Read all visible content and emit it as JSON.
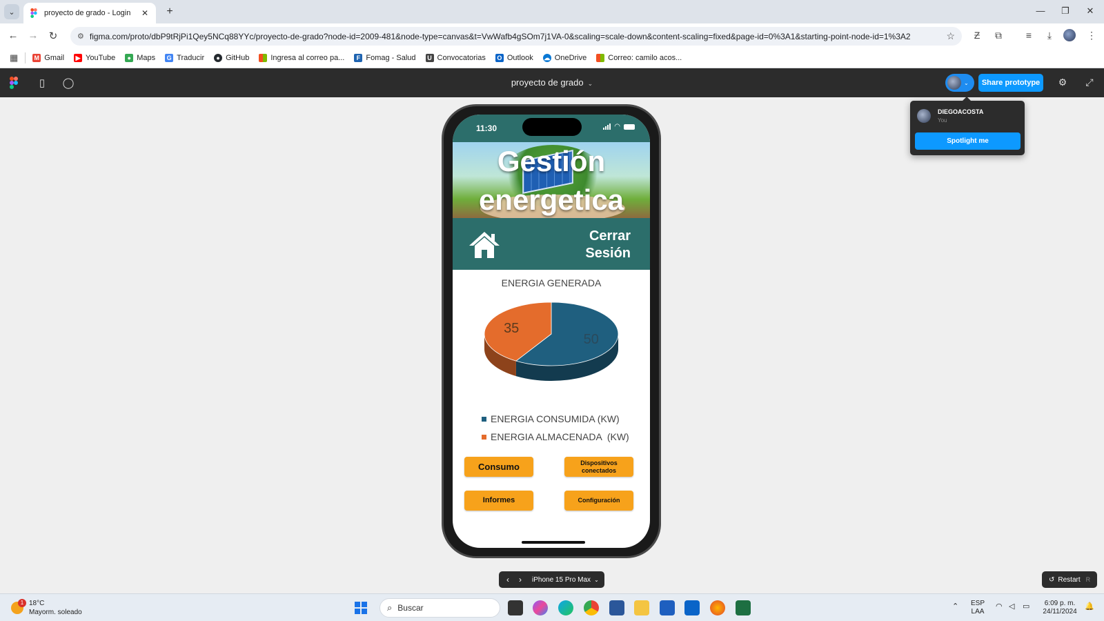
{
  "browser": {
    "tab_title": "proyecto de grado - Login",
    "url": "figma.com/proto/dbP9tRjPi1Qey5NCq88YYc/proyecto-de-grado?node-id=2009-481&node-type=canvas&t=VwWafb4gSOm7j1VA-0&scaling=scale-down&content-scaling=fixed&page-id=0%3A1&starting-point-node-id=1%3A2",
    "bookmarks": [
      {
        "label": "Gmail",
        "icon": "gmail-icon",
        "color": "#ea4335"
      },
      {
        "label": "YouTube",
        "icon": "youtube-icon",
        "color": "#ff0000"
      },
      {
        "label": "Maps",
        "icon": "maps-icon",
        "color": "#34a853"
      },
      {
        "label": "Traducir",
        "icon": "translate-icon",
        "color": "#4285f4"
      },
      {
        "label": "GitHub",
        "icon": "github-icon",
        "color": "#24292e"
      },
      {
        "label": "Ingresa al correo pa...",
        "icon": "microsoft-icon",
        "color": "#f25022"
      },
      {
        "label": "Fomag - Salud",
        "icon": "fomag-icon",
        "color": "#1e63b0"
      },
      {
        "label": "Convocatorias",
        "icon": "convocatorias-icon",
        "color": "#444444"
      },
      {
        "label": "Outlook",
        "icon": "outlook-icon",
        "color": "#0a64c8"
      },
      {
        "label": "OneDrive",
        "icon": "onedrive-icon",
        "color": "#0a78d4"
      },
      {
        "label": "Correo: camilo acos...",
        "icon": "microsoft-icon",
        "color": "#f25022"
      }
    ]
  },
  "figma": {
    "file_title": "proyecto de grado",
    "share_label": "Share prototype",
    "popover": {
      "name": "DIEGOACOSTA",
      "sub": "You",
      "spotlight_label": "Spotlight me"
    },
    "device_name": "iPhone 15 Pro Max",
    "restart_label": "Restart",
    "restart_key": "R"
  },
  "phone": {
    "time": "11:30",
    "hero_title": "Gestión energetica",
    "logout_label": "Cerrar Sesión",
    "chart_title": "ENERGIA GENERADA",
    "buttons": {
      "consumo": "Consumo",
      "dispositivos": "Dispositivos conectados",
      "informes": "Informes",
      "configuracion": "Configuración"
    }
  },
  "chart_data": {
    "type": "pie",
    "title": "ENERGIA GENERADA",
    "categories": [
      "ENERGIA CONSUMIDA (KW)",
      "ENERGIA ALMACENADA  (KW)"
    ],
    "values": [
      50,
      35
    ],
    "colors": [
      "#1f5f7f",
      "#e46c2c"
    ],
    "legend_position": "bottom"
  },
  "taskbar": {
    "weather_temp": "18°C",
    "weather_desc": "Mayorm. soleado",
    "weather_badge": "1",
    "search_placeholder": "Buscar",
    "lang_line1": "ESP",
    "lang_line2": "LAA",
    "clock_time": "6:09 p. m.",
    "clock_date": "24/11/2024"
  }
}
